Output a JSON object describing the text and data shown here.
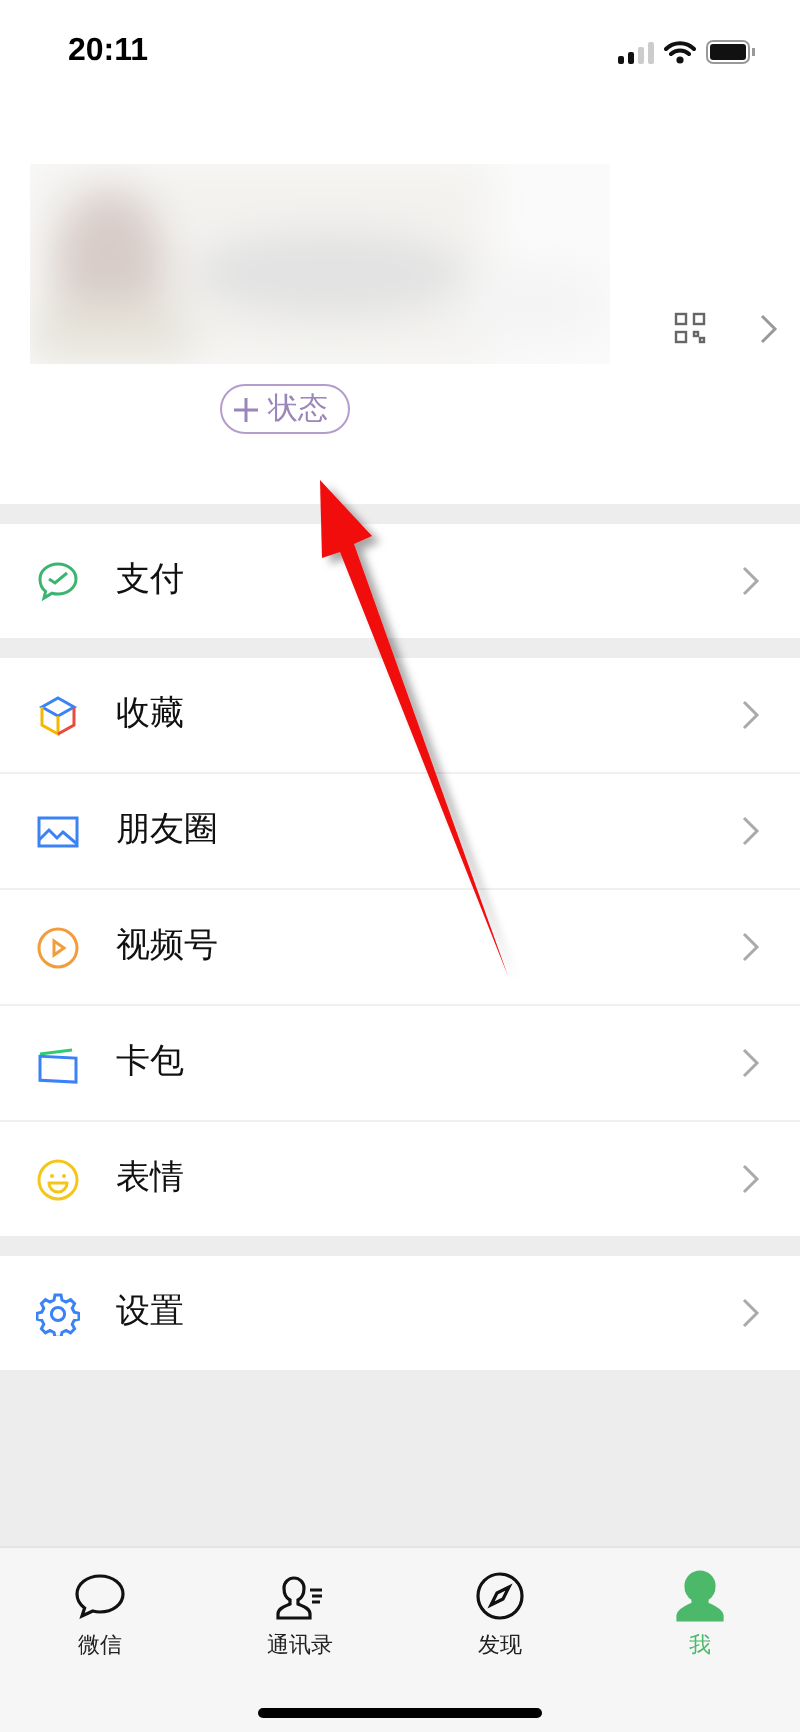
{
  "status_bar": {
    "time": "20:11"
  },
  "profile": {
    "status_button": "状态"
  },
  "menu_groups": [
    [
      {
        "kind": "pay",
        "label": "支付"
      }
    ],
    [
      {
        "kind": "favorites",
        "label": "收藏"
      },
      {
        "kind": "moments",
        "label": "朋友圈"
      },
      {
        "kind": "channels",
        "label": "视频号"
      },
      {
        "kind": "cards",
        "label": "卡包"
      },
      {
        "kind": "stickers",
        "label": "表情"
      }
    ],
    [
      {
        "kind": "settings",
        "label": "设置"
      }
    ]
  ],
  "tabs": [
    {
      "kind": "chats",
      "label": "微信",
      "selected": false
    },
    {
      "kind": "contacts",
      "label": "通讯录",
      "selected": false
    },
    {
      "kind": "discover",
      "label": "发现",
      "selected": false
    },
    {
      "kind": "me",
      "label": "我",
      "selected": true
    }
  ]
}
